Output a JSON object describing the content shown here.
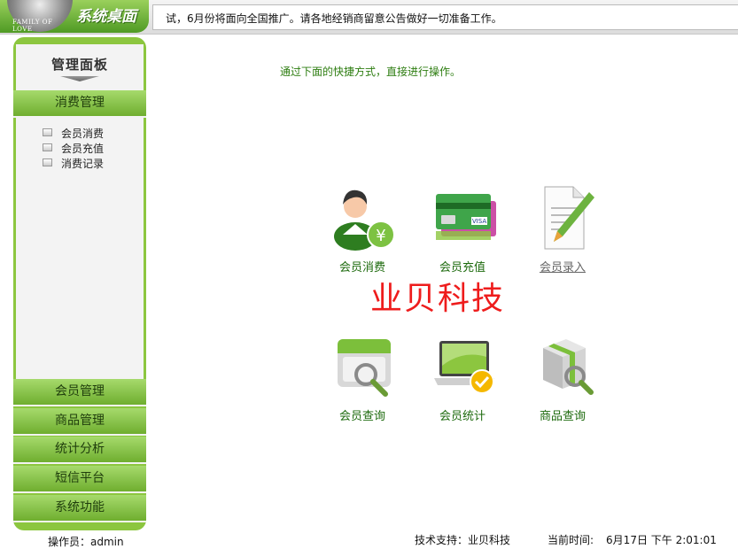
{
  "header": {
    "logo_text": "FAMILY OF LOVE",
    "brand": "系统桌面",
    "notice": "试，6月份将面向全国推广。请各地经销商留意公告做好一切准备工作。"
  },
  "sidebar": {
    "title": "管理面板",
    "sections": [
      {
        "label": "消费管理",
        "items": [
          "会员消费",
          "会员充值",
          "消费记录"
        ]
      },
      {
        "label": "会员管理"
      },
      {
        "label": "商品管理"
      },
      {
        "label": "统计分析"
      },
      {
        "label": "短信平台"
      },
      {
        "label": "系统功能"
      }
    ]
  },
  "main": {
    "hint": "通过下面的快捷方式，直接进行操作。",
    "shortcuts": [
      {
        "label": "会员消费",
        "icon": "member-consume-icon"
      },
      {
        "label": "会员充值",
        "icon": "member-recharge-icon"
      },
      {
        "label": "会员录入",
        "icon": "member-entry-icon"
      },
      {
        "label": "会员查询",
        "icon": "member-query-icon"
      },
      {
        "label": "会员统计",
        "icon": "member-stats-icon"
      },
      {
        "label": "商品查询",
        "icon": "product-query-icon"
      }
    ],
    "watermark": "业贝科技"
  },
  "footer": {
    "operator_label": "操作员：",
    "operator_name": "admin",
    "support_label": "技术支持：",
    "support_value": "业贝科技",
    "time_label": "当前时间:",
    "time_value": "6月17日 下午 2:01:01"
  },
  "colors": {
    "accent_green": "#8cc63f",
    "text_green": "#2d7d10",
    "watermark_red": "#ee1c1c"
  }
}
